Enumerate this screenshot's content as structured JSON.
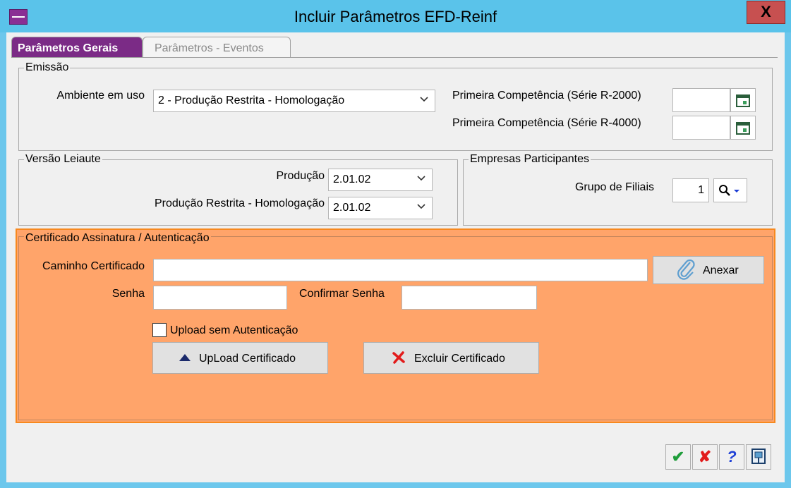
{
  "window": {
    "title": "Incluir Parâmetros EFD-Reinf",
    "close_label": "X"
  },
  "tabs": [
    {
      "label": "Parâmetros Gerais",
      "active": true
    },
    {
      "label": "Parâmetros - Eventos",
      "active": false
    }
  ],
  "emissao": {
    "title": "Emissão",
    "ambiente_label": "Ambiente em uso",
    "ambiente_value": "2 - Produção Restrita - Homologação",
    "r2000_label": "Primeira Competência (Série R-2000)",
    "r2000_value": "",
    "r4000_label": "Primeira Competência (Série R-4000)",
    "r4000_value": ""
  },
  "versao": {
    "title": "Versão Leiaute",
    "producao_label": "Produção",
    "producao_value": "2.01.02",
    "restrita_label": "Produção Restrita - Homologação",
    "restrita_value": "2.01.02"
  },
  "empresas": {
    "title": "Empresas Participantes",
    "grupo_label": "Grupo de Filiais",
    "grupo_value": "1"
  },
  "certificado": {
    "title": "Certificado Assinatura / Autenticação",
    "caminho_label": "Caminho Certificado",
    "caminho_value": "",
    "anexar_label": "Anexar",
    "senha_label": "Senha",
    "senha_value": "",
    "confirmar_label": "Confirmar Senha",
    "confirmar_value": "",
    "upload_sem_auth_label": "Upload sem Autenticação",
    "upload_sem_auth_checked": false,
    "upload_btn_label": "UpLoad Certificado",
    "excluir_btn_label": "Excluir Certificado"
  },
  "bottom_buttons": {
    "ok": "✔",
    "cancel": "✘",
    "help": "?"
  },
  "colors": {
    "accent": "#7b2b86",
    "title_bar": "#5ac3ea",
    "cert_bg": "#ffa46a",
    "cert_border": "#f7891f"
  }
}
